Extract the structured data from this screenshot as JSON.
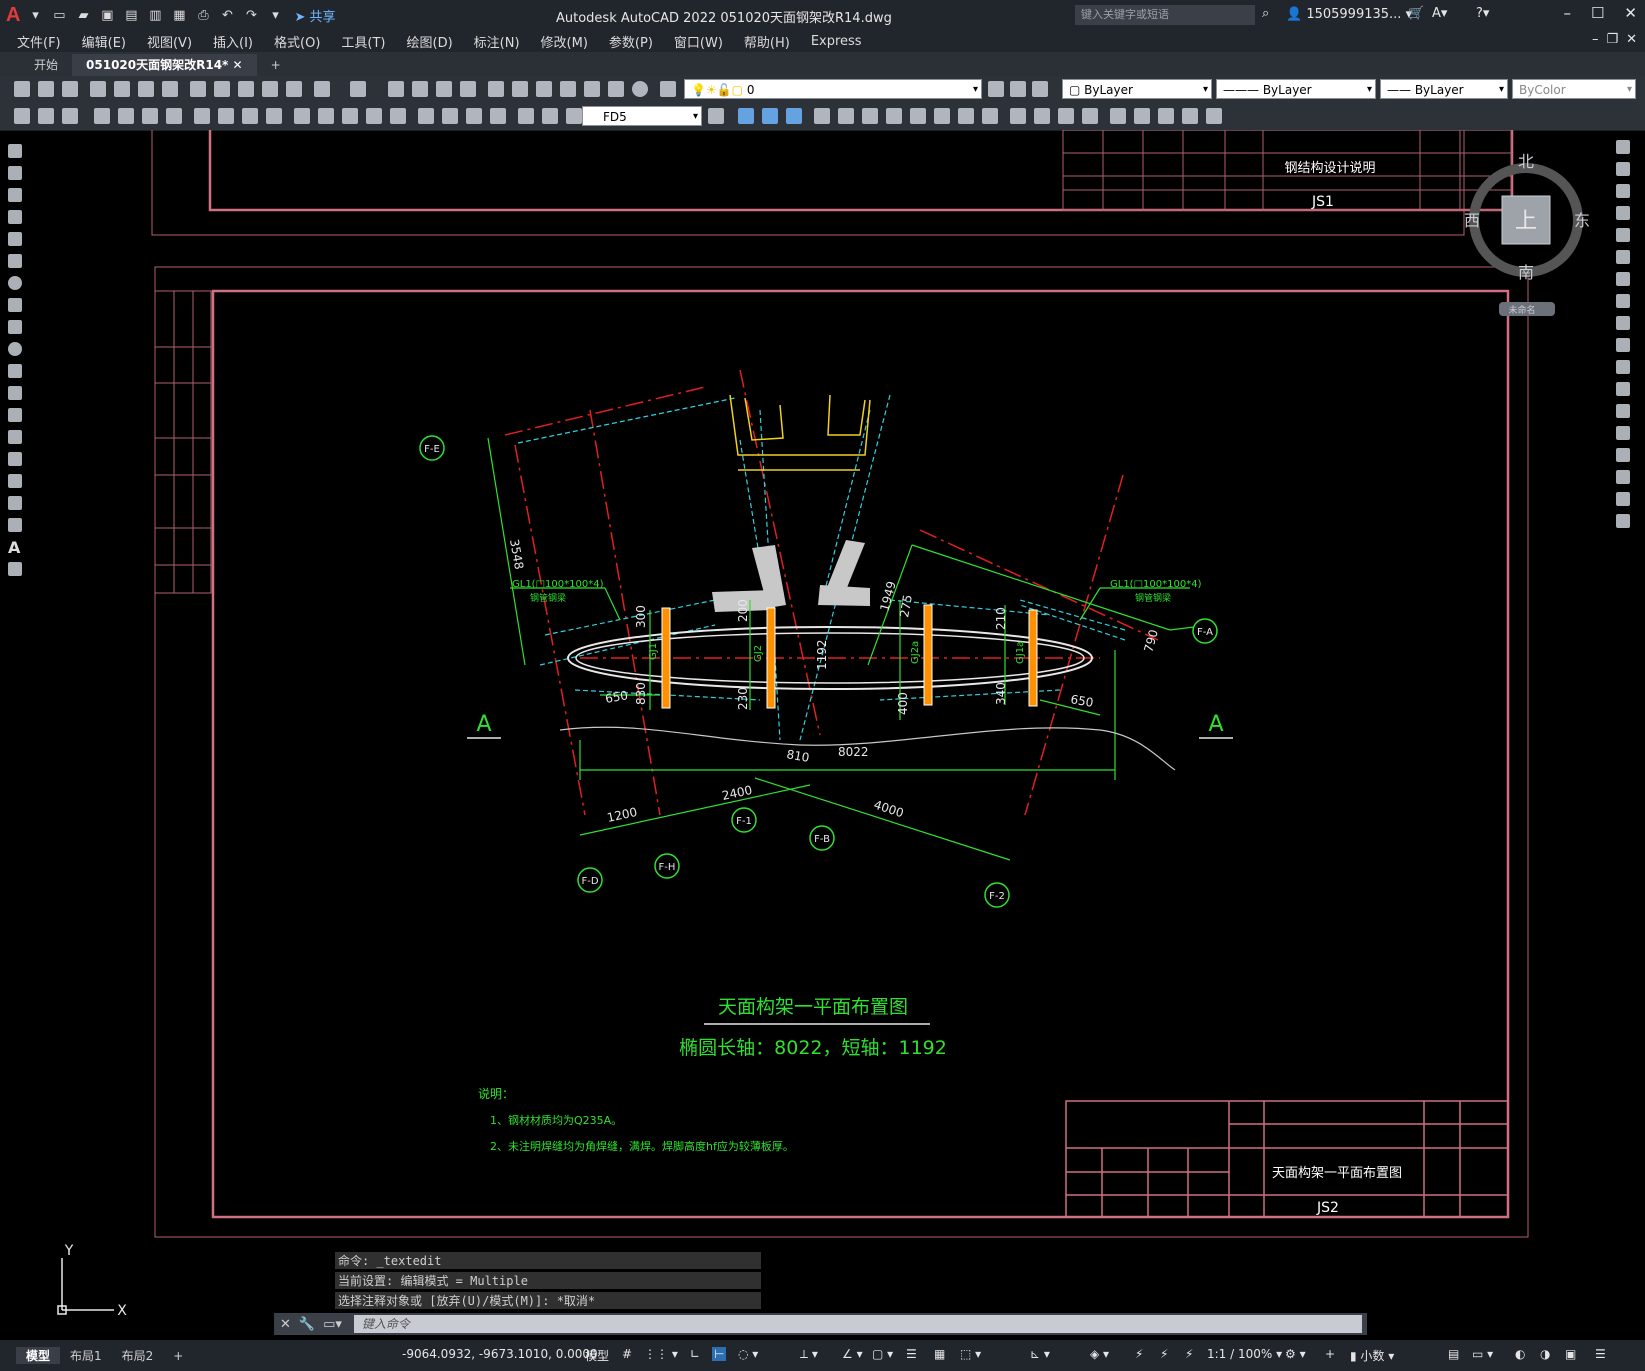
{
  "app": {
    "title": "Autodesk AutoCAD 2022    051020天面钢架改R14.dwg",
    "share_label": "共享",
    "search_placeholder": "键入关键字或短语",
    "user": "1505999135..."
  },
  "menu": [
    "文件(F)",
    "编辑(E)",
    "视图(V)",
    "插入(I)",
    "格式(O)",
    "工具(T)",
    "绘图(D)",
    "标注(N)",
    "修改(M)",
    "参数(P)",
    "窗口(W)",
    "帮助(H)",
    "Express"
  ],
  "tabs": [
    "开始",
    "051020天面钢架改R14*"
  ],
  "toolbar": {
    "layer_value": "0",
    "color_value": "ByLayer",
    "linetype_value": "ByLayer",
    "lineweight_value": "ByLayer",
    "plotstyle_value": "ByColor",
    "dimstyle_value": "FD5"
  },
  "viewcube": {
    "north": "北",
    "south": "南",
    "east": "东",
    "west": "西",
    "top": "上",
    "unnamed": "未命名"
  },
  "drawing": {
    "top_titleblock": {
      "title": "钢结构设计说明",
      "number": "JS1"
    },
    "main_title": "天面构架一平面布置图",
    "subtitle": "椭圆长轴：8022，短轴：1192",
    "notes_heading": "说明：",
    "note1": "1、钢材材质均为Q235A。",
    "note2": "2、未注明焊缝均为角焊缝，满焊。焊脚高度hf应为较薄板厚。",
    "bottom_titleblock": {
      "title": "天面构架一平面布置图",
      "number": "JS2"
    },
    "section_label": "A",
    "gl1_left": "GL1(□100*100*4)",
    "gl1_right": "GL1(□100*100*4)",
    "gl_sub": "钢管钢梁",
    "dims": [
      "3548",
      "1949",
      "275",
      "790",
      "300",
      "200",
      "210",
      "830",
      "230",
      "400",
      "340",
      "650",
      "650",
      "1192",
      "810",
      "8022",
      "1200",
      "2400",
      "4000"
    ],
    "beams": [
      "GJ1",
      "GJ2",
      "GJ2a",
      "GJ1a"
    ],
    "axes": [
      "F-E",
      "F-A",
      "F-1",
      "F-B",
      "F-2",
      "F-D",
      "F-H"
    ]
  },
  "command": {
    "history": [
      "命令: _textedit",
      "当前设置: 编辑模式 = Multiple",
      "选择注释对象或 [放弃(U)/模式(M)]: *取消*"
    ],
    "placeholder": "键入命令"
  },
  "layout_tabs": [
    "模型",
    "布局1",
    "布局2"
  ],
  "status": {
    "coords": "-9064.0932, -9673.1010, 0.0000",
    "model": "模型",
    "scale": "1:1 / 100%",
    "units": "小数"
  },
  "ucs": {
    "x": "X",
    "y": "Y"
  }
}
